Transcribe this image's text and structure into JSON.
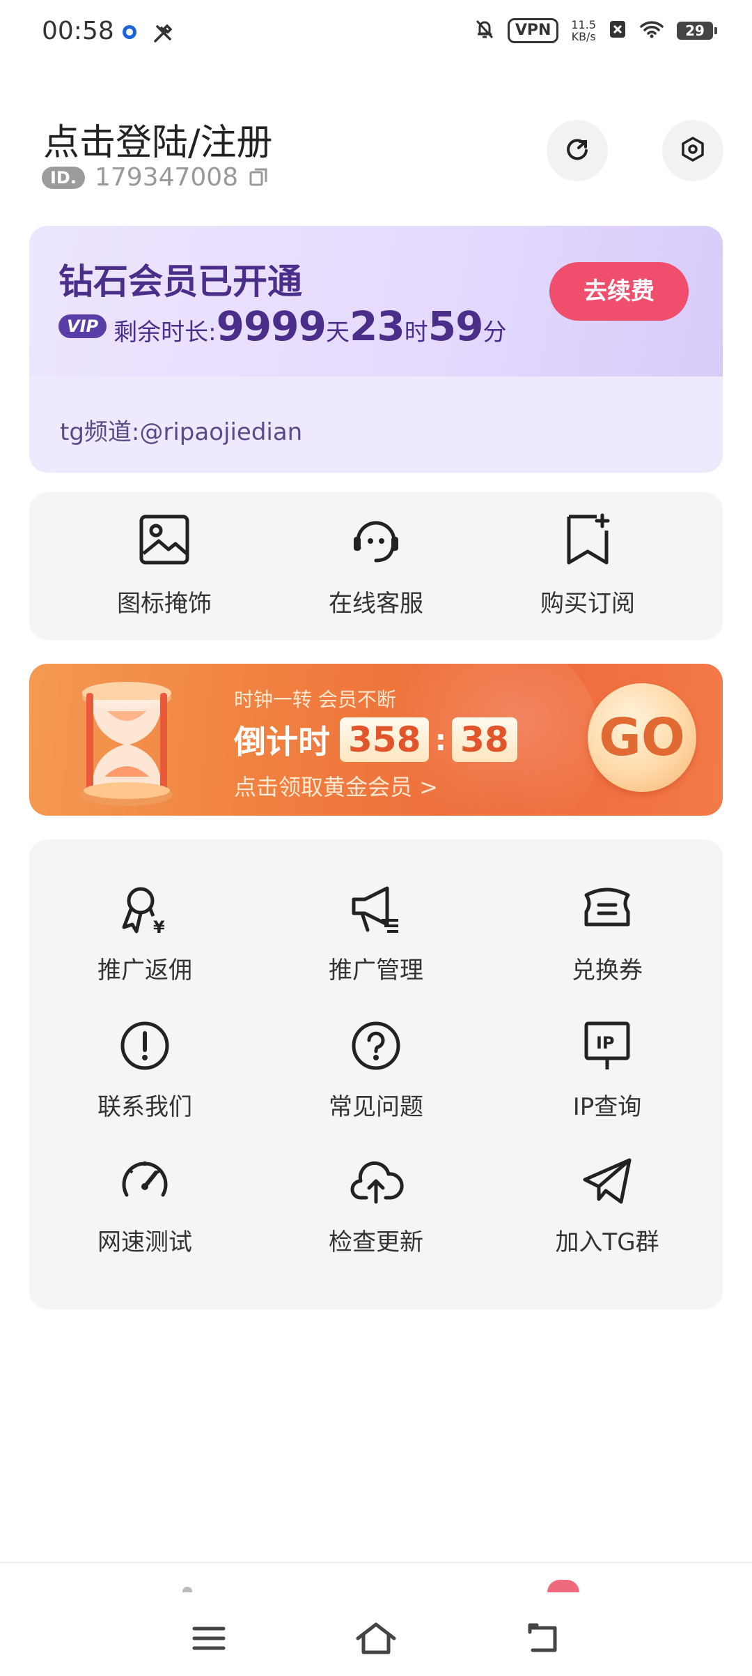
{
  "status_bar": {
    "time": "00:58",
    "vpn": "VPN",
    "speed_value": "11.5",
    "speed_unit": "KB/s",
    "battery": "29",
    "icons": [
      "dot-icon",
      "tools-icon",
      "mute-bell-icon",
      "close-box-icon",
      "wifi-icon",
      "battery-icon"
    ]
  },
  "header": {
    "login_title": "点击登陆/注册",
    "id_badge": "ID.",
    "id_number": "179347008",
    "icons": [
      "copy-icon",
      "refresh-icon",
      "settings-icon"
    ]
  },
  "vip": {
    "title": "钻石会员已开通",
    "pill": "VIP",
    "remain_label": "剩余时长:",
    "days": "9999",
    "days_unit": "天",
    "hours": "23",
    "hours_unit": "时",
    "minutes": "59",
    "minutes_unit": "分",
    "renew_label": "去续费",
    "channel": "tg频道:@ripaojiedian"
  },
  "quick_actions": [
    {
      "label": "图标掩饰",
      "icon": "image-icon"
    },
    {
      "label": "在线客服",
      "icon": "headset-icon"
    },
    {
      "label": "购买订阅",
      "icon": "bookmark-add-icon"
    }
  ],
  "promo": {
    "line1": "时钟一转 会员不断",
    "countdown_label": "倒计时",
    "count_a": "358",
    "separator": ":",
    "count_b": "38",
    "line3": "点击领取黄金会员 >",
    "go_label": "GO",
    "icon": "hourglass-icon"
  },
  "menu": [
    {
      "label": "推广返佣",
      "icon": "award-yen-icon"
    },
    {
      "label": "推广管理",
      "icon": "megaphone-icon"
    },
    {
      "label": "兑换券",
      "icon": "ticket-icon"
    },
    {
      "label": "联系我们",
      "icon": "alert-circle-icon"
    },
    {
      "label": "常见问题",
      "icon": "help-circle-icon"
    },
    {
      "label": "IP查询",
      "icon": "ip-sign-icon"
    },
    {
      "label": "网速测试",
      "icon": "speedometer-icon"
    },
    {
      "label": "检查更新",
      "icon": "cloud-upload-icon"
    },
    {
      "label": "加入TG群",
      "icon": "telegram-icon"
    }
  ],
  "nav": {
    "icons": [
      "menu-icon",
      "home-icon",
      "back-icon"
    ]
  },
  "colors": {
    "vip_text": "#4a2e8a",
    "renew_button": "#ef4f6c",
    "promo_orange": "#f08040",
    "card_gray": "#f5f5f5"
  }
}
